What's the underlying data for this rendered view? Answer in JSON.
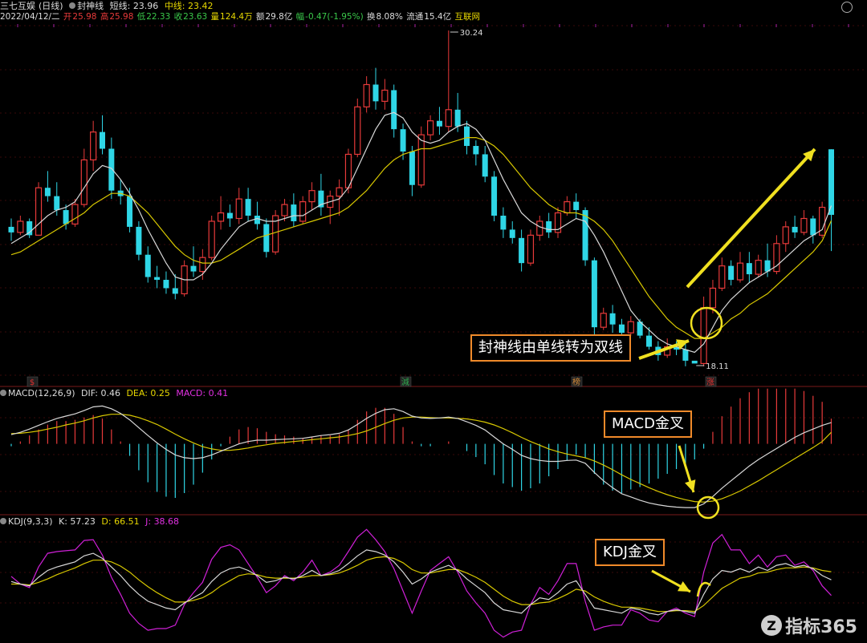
{
  "header": {
    "stock_name": "三七互娱",
    "period": "(日线)",
    "indicator_name": "封神线",
    "short_label": "短线:",
    "short_value": "23.96",
    "mid_label": "中线:",
    "mid_value": "23.42"
  },
  "ohlc": {
    "date": "2022/04/12/二",
    "open_label": "开",
    "open": "25.98",
    "high_label": "高",
    "high": "25.98",
    "low_label": "低",
    "low": "22.33",
    "close_label": "收",
    "close": "23.63",
    "vol_label": "量",
    "vol": "124.4万",
    "amount_label": "额",
    "amount": "29.8亿",
    "change_label": "幅",
    "change": "-0.47(-1.95%)",
    "turnover_label": "换",
    "turnover": "8.08%",
    "float_label": "流通",
    "float": "15.4亿",
    "source": "互联网"
  },
  "macd_header": {
    "name": "MACD(12,26,9)",
    "dif_label": "DIF:",
    "dif": "0.46",
    "dea_label": "DEA:",
    "dea": "0.25",
    "macd_label": "MACD:",
    "macd": "0.41"
  },
  "kdj_header": {
    "name": "KDJ(9,3,3)",
    "k_label": "K:",
    "k": "57.23",
    "d_label": "D:",
    "d": "66.51",
    "j_label": "J:",
    "j": "38.68"
  },
  "annotations": {
    "high_marker": "30.24",
    "low_marker": "18.11",
    "callout_main": "封神线由单线转为双线",
    "callout_macd": "MACD金叉",
    "callout_kdj": "KDJ金叉"
  },
  "event_tags": [
    {
      "text": "$",
      "color": "#e03030"
    },
    {
      "text": "減",
      "color": "#2fa84f"
    },
    {
      "text": "榜",
      "color": "#d08a3a"
    },
    {
      "text": "涨",
      "color": "#e03030"
    }
  ],
  "watermark": {
    "logo": "Z",
    "text": "指标365"
  },
  "colors": {
    "up": "#e83a3a",
    "down": "#2fd6e6",
    "short_line": "#d8d8d8",
    "mid_line": "#d8c800",
    "dif": "#d8d8d8",
    "dea": "#d8c800",
    "k": "#d8d8d8",
    "d": "#d8c800",
    "j": "#d020d8",
    "highlight": "#f0e020",
    "arrow": "#f0e020"
  },
  "chart_data": {
    "type": "candlestick",
    "price_range": [
      18.11,
      30.24
    ],
    "ohlc": [
      [
        23.2,
        23.5,
        22.7,
        23.0
      ],
      [
        23.0,
        23.6,
        22.9,
        23.4
      ],
      [
        23.4,
        23.5,
        22.8,
        22.9
      ],
      [
        22.9,
        24.8,
        22.9,
        24.6
      ],
      [
        24.6,
        25.2,
        24.1,
        24.3
      ],
      [
        24.3,
        24.8,
        23.6,
        23.8
      ],
      [
        23.8,
        24.0,
        23.1,
        23.3
      ],
      [
        23.3,
        24.2,
        23.2,
        24.0
      ],
      [
        24.0,
        26.0,
        23.9,
        25.6
      ],
      [
        25.6,
        27.0,
        25.2,
        26.6
      ],
      [
        26.6,
        27.2,
        25.8,
        26.0
      ],
      [
        26.0,
        26.4,
        24.2,
        24.5
      ],
      [
        24.5,
        24.9,
        24.0,
        24.3
      ],
      [
        24.3,
        24.6,
        23.0,
        23.2
      ],
      [
        23.2,
        23.4,
        22.0,
        22.2
      ],
      [
        22.2,
        22.5,
        21.2,
        21.4
      ],
      [
        21.4,
        21.8,
        21.0,
        21.3
      ],
      [
        21.3,
        21.6,
        20.8,
        21.0
      ],
      [
        21.0,
        21.5,
        20.6,
        20.8
      ],
      [
        20.8,
        22.0,
        20.7,
        21.8
      ],
      [
        21.8,
        22.5,
        21.4,
        21.6
      ],
      [
        21.6,
        22.4,
        21.3,
        22.1
      ],
      [
        22.1,
        23.6,
        22.0,
        23.4
      ],
      [
        23.4,
        24.3,
        23.1,
        23.7
      ],
      [
        23.7,
        24.0,
        23.2,
        23.5
      ],
      [
        23.5,
        24.6,
        23.3,
        24.2
      ],
      [
        24.2,
        24.6,
        23.4,
        23.6
      ],
      [
        23.6,
        24.1,
        23.1,
        23.3
      ],
      [
        23.3,
        23.5,
        22.1,
        22.3
      ],
      [
        22.3,
        23.8,
        22.2,
        23.6
      ],
      [
        23.6,
        24.2,
        23.4,
        24.0
      ],
      [
        24.0,
        24.4,
        23.2,
        23.4
      ],
      [
        23.4,
        24.3,
        23.3,
        24.1
      ],
      [
        24.1,
        24.8,
        23.8,
        24.5
      ],
      [
        24.5,
        25.1,
        23.6,
        23.9
      ],
      [
        23.9,
        24.5,
        23.3,
        24.3
      ],
      [
        24.3,
        24.9,
        23.6,
        24.6
      ],
      [
        24.6,
        26.0,
        24.4,
        25.8
      ],
      [
        25.8,
        27.8,
        25.7,
        27.5
      ],
      [
        27.5,
        28.6,
        27.3,
        28.3
      ],
      [
        28.3,
        28.9,
        27.4,
        27.7
      ],
      [
        27.7,
        28.5,
        27.4,
        28.1
      ],
      [
        28.1,
        28.3,
        26.4,
        26.7
      ],
      [
        26.7,
        26.9,
        25.6,
        25.9
      ],
      [
        25.9,
        26.1,
        24.3,
        24.7
      ],
      [
        24.7,
        26.8,
        24.6,
        26.5
      ],
      [
        26.5,
        27.2,
        26.3,
        27.0
      ],
      [
        27.0,
        27.5,
        26.5,
        26.8
      ],
      [
        26.8,
        30.24,
        26.6,
        27.4
      ],
      [
        27.4,
        28.0,
        26.6,
        26.8
      ],
      [
        26.8,
        27.0,
        25.8,
        26.1
      ],
      [
        26.1,
        26.3,
        25.4,
        25.8
      ],
      [
        25.8,
        26.1,
        24.8,
        25.0
      ],
      [
        25.0,
        25.2,
        23.4,
        23.6
      ],
      [
        23.6,
        23.9,
        22.8,
        23.1
      ],
      [
        23.1,
        23.4,
        22.6,
        22.8
      ],
      [
        22.8,
        23.1,
        21.6,
        21.9
      ],
      [
        21.9,
        23.1,
        21.8,
        22.9
      ],
      [
        22.9,
        23.6,
        22.7,
        23.4
      ],
      [
        23.4,
        23.7,
        22.8,
        23.0
      ],
      [
        23.0,
        23.9,
        22.8,
        23.7
      ],
      [
        23.7,
        24.3,
        23.6,
        24.1
      ],
      [
        24.1,
        24.4,
        23.5,
        23.8
      ],
      [
        23.8,
        23.9,
        21.8,
        22.0
      ],
      [
        22.0,
        22.1,
        19.3,
        19.6
      ],
      [
        19.6,
        20.3,
        19.5,
        20.1
      ],
      [
        20.1,
        20.4,
        19.4,
        19.7
      ],
      [
        19.7,
        19.9,
        19.2,
        19.4
      ],
      [
        19.4,
        20.0,
        19.3,
        19.8
      ],
      [
        19.8,
        19.9,
        19.2,
        19.3
      ],
      [
        19.3,
        19.6,
        18.8,
        18.9
      ],
      [
        18.9,
        19.1,
        18.4,
        18.6
      ],
      [
        18.6,
        19.2,
        18.5,
        18.9
      ],
      [
        18.9,
        19.1,
        18.6,
        18.8
      ],
      [
        18.8,
        19.0,
        18.2,
        18.4
      ],
      [
        18.4,
        18.11,
        18.11,
        18.3
      ],
      [
        18.3,
        20.7,
        18.2,
        20.3
      ],
      [
        20.3,
        21.3,
        20.1,
        21.0
      ],
      [
        21.0,
        22.1,
        20.9,
        21.8
      ],
      [
        21.8,
        22.0,
        21.1,
        21.3
      ],
      [
        21.3,
        22.3,
        21.2,
        21.9
      ],
      [
        21.9,
        22.3,
        21.2,
        21.5
      ],
      [
        21.5,
        22.2,
        21.4,
        22.0
      ],
      [
        22.0,
        22.6,
        21.4,
        21.6
      ],
      [
        21.6,
        22.9,
        21.5,
        22.6
      ],
      [
        22.6,
        23.4,
        22.3,
        23.2
      ],
      [
        23.2,
        23.6,
        22.8,
        23.0
      ],
      [
        23.0,
        23.8,
        22.9,
        23.5
      ],
      [
        23.5,
        23.6,
        22.6,
        22.9
      ],
      [
        22.9,
        24.1,
        22.8,
        23.9
      ],
      [
        25.98,
        25.98,
        22.33,
        23.63
      ]
    ],
    "short_line": [
      22.6,
      22.8,
      23.0,
      23.3,
      23.6,
      23.8,
      23.9,
      24.1,
      24.6,
      25.1,
      25.4,
      25.3,
      24.9,
      24.4,
      23.8,
      23.1,
      22.5,
      21.9,
      21.4,
      21.3,
      21.3,
      21.5,
      21.9,
      22.4,
      22.8,
      23.2,
      23.4,
      23.5,
      23.4,
      23.4,
      23.5,
      23.6,
      23.6,
      23.8,
      24.0,
      24.1,
      24.2,
      24.6,
      25.3,
      26.0,
      26.7,
      27.2,
      27.3,
      27.1,
      26.6,
      26.3,
      26.2,
      26.3,
      26.6,
      26.8,
      26.9,
      26.7,
      26.3,
      25.6,
      24.9,
      24.3,
      23.7,
      23.4,
      23.2,
      23.1,
      23.1,
      23.3,
      23.5,
      23.4,
      22.9,
      22.3,
      21.6,
      20.9,
      20.2,
      19.8,
      19.5,
      19.2,
      19.0,
      18.9,
      18.8,
      18.7,
      19.0,
      19.6,
      20.2,
      20.6,
      20.9,
      21.2,
      21.4,
      21.6,
      21.8,
      22.1,
      22.4,
      22.7,
      22.9,
      23.1,
      23.96
    ],
    "mid_line": [
      22.2,
      22.3,
      22.5,
      22.7,
      22.9,
      23.1,
      23.3,
      23.5,
      23.7,
      24.0,
      24.2,
      24.4,
      24.4,
      24.3,
      24.0,
      23.7,
      23.3,
      22.9,
      22.5,
      22.2,
      22.0,
      21.9,
      21.9,
      22.0,
      22.2,
      22.4,
      22.6,
      22.8,
      22.9,
      23.0,
      23.1,
      23.2,
      23.3,
      23.4,
      23.5,
      23.6,
      23.7,
      23.9,
      24.2,
      24.5,
      24.9,
      25.3,
      25.6,
      25.8,
      25.9,
      26.0,
      26.0,
      26.1,
      26.2,
      26.3,
      26.4,
      26.4,
      26.3,
      26.1,
      25.8,
      25.4,
      25.0,
      24.6,
      24.3,
      24.0,
      23.8,
      23.7,
      23.7,
      23.6,
      23.4,
      23.1,
      22.7,
      22.2,
      21.7,
      21.2,
      20.7,
      20.3,
      19.9,
      19.6,
      19.4,
      19.2,
      19.2,
      19.4,
      19.6,
      19.9,
      20.1,
      20.4,
      20.6,
      20.8,
      21.1,
      21.4,
      21.7,
      22.0,
      22.3,
      22.7,
      23.42
    ],
    "macd": {
      "dif": [
        0.2,
        0.25,
        0.32,
        0.4,
        0.48,
        0.55,
        0.6,
        0.65,
        0.72,
        0.8,
        0.82,
        0.76,
        0.66,
        0.52,
        0.35,
        0.18,
        0.02,
        -0.12,
        -0.24,
        -0.3,
        -0.32,
        -0.3,
        -0.24,
        -0.16,
        -0.08,
        0.0,
        0.05,
        0.08,
        0.08,
        0.09,
        0.1,
        0.11,
        0.12,
        0.15,
        0.18,
        0.2,
        0.23,
        0.3,
        0.42,
        0.55,
        0.66,
        0.74,
        0.76,
        0.7,
        0.6,
        0.56,
        0.55,
        0.56,
        0.58,
        0.55,
        0.48,
        0.4,
        0.3,
        0.15,
        0.0,
        -0.12,
        -0.25,
        -0.32,
        -0.36,
        -0.38,
        -0.38,
        -0.36,
        -0.35,
        -0.42,
        -0.62,
        -0.8,
        -0.95,
        -1.08,
        -1.15,
        -1.22,
        -1.28,
        -1.32,
        -1.35,
        -1.37,
        -1.38,
        -1.38,
        -1.3,
        -1.14,
        -0.96,
        -0.8,
        -0.64,
        -0.48,
        -0.34,
        -0.22,
        -0.1,
        0.02,
        0.14,
        0.24,
        0.32,
        0.4,
        0.46
      ],
      "dea": [
        0.22,
        0.23,
        0.25,
        0.28,
        0.32,
        0.36,
        0.41,
        0.45,
        0.5,
        0.56,
        0.61,
        0.64,
        0.64,
        0.62,
        0.57,
        0.5,
        0.42,
        0.32,
        0.21,
        0.11,
        0.02,
        -0.06,
        -0.11,
        -0.14,
        -0.14,
        -0.12,
        -0.09,
        -0.05,
        -0.02,
        0.01,
        0.03,
        0.05,
        0.07,
        0.09,
        0.11,
        0.13,
        0.15,
        0.18,
        0.22,
        0.28,
        0.36,
        0.44,
        0.51,
        0.56,
        0.58,
        0.58,
        0.57,
        0.56,
        0.56,
        0.55,
        0.54,
        0.51,
        0.47,
        0.41,
        0.33,
        0.24,
        0.14,
        0.05,
        -0.03,
        -0.11,
        -0.17,
        -0.22,
        -0.26,
        -0.3,
        -0.37,
        -0.46,
        -0.56,
        -0.67,
        -0.77,
        -0.86,
        -0.95,
        -1.03,
        -1.1,
        -1.16,
        -1.21,
        -1.25,
        -1.26,
        -1.24,
        -1.19,
        -1.11,
        -1.02,
        -0.91,
        -0.8,
        -0.68,
        -0.56,
        -0.44,
        -0.32,
        -0.2,
        -0.08,
        0.05,
        0.25
      ],
      "hist": "2*(dif-dea)"
    },
    "kdj": {
      "k": [
        55,
        52,
        50,
        60,
        68,
        72,
        75,
        78,
        85,
        88,
        82,
        72,
        62,
        50,
        40,
        32,
        28,
        24,
        22,
        30,
        36,
        42,
        55,
        65,
        70,
        72,
        68,
        62,
        54,
        56,
        60,
        58,
        62,
        68,
        62,
        64,
        68,
        76,
        85,
        92,
        90,
        86,
        78,
        66,
        52,
        58,
        66,
        70,
        74,
        68,
        58,
        50,
        42,
        30,
        22,
        20,
        18,
        28,
        36,
        34,
        42,
        52,
        56,
        40,
        24,
        22,
        20,
        18,
        24,
        22,
        18,
        16,
        20,
        22,
        20,
        18,
        40,
        58,
        68,
        66,
        70,
        66,
        72,
        68,
        74,
        76,
        72,
        74,
        70,
        62,
        57
      ],
      "d": [
        52,
        52,
        51,
        54,
        58,
        63,
        67,
        71,
        76,
        80,
        80,
        78,
        73,
        66,
        57,
        49,
        42,
        36,
        31,
        31,
        33,
        36,
        42,
        50,
        56,
        62,
        64,
        63,
        60,
        59,
        59,
        59,
        60,
        62,
        62,
        63,
        65,
        69,
        74,
        80,
        83,
        84,
        82,
        77,
        69,
        65,
        65,
        67,
        69,
        69,
        65,
        60,
        54,
        46,
        38,
        32,
        28,
        28,
        30,
        31,
        35,
        40,
        46,
        44,
        37,
        32,
        28,
        25,
        25,
        24,
        22,
        20,
        20,
        21,
        21,
        20,
        27,
        37,
        47,
        53,
        59,
        61,
        65,
        66,
        69,
        71,
        71,
        72,
        71,
        68,
        66.51
      ],
      "j": [
        61,
        52,
        48,
        72,
        88,
        90,
        91,
        92,
        103,
        104,
        86,
        60,
        40,
        18,
        6,
        -2,
        0,
        0,
        4,
        28,
        42,
        54,
        81,
        95,
        98,
        92,
        76,
        60,
        42,
        50,
        62,
        56,
        66,
        80,
        62,
        66,
        74,
        90,
        107,
        116,
        104,
        90,
        70,
        44,
        18,
        44,
        68,
        76,
        84,
        66,
        44,
        30,
        18,
        -2,
        -10,
        -4,
        -2,
        28,
        48,
        40,
        56,
        76,
        76,
        32,
        -2,
        2,
        4,
        4,
        22,
        18,
        10,
        8,
        20,
        24,
        18,
        14,
        66,
        100,
        110,
        92,
        92,
        76,
        86,
        72,
        84,
        86,
        74,
        78,
        68,
        50,
        38.68
      ]
    }
  }
}
